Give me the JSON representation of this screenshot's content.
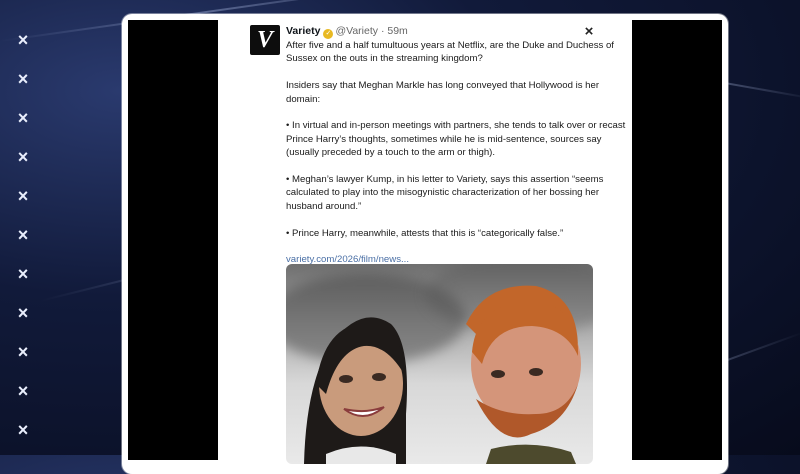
{
  "side_panel": {
    "close_icons": [
      "×",
      "×",
      "×",
      "×",
      "×",
      "×",
      "×",
      "×",
      "×",
      "×",
      "×",
      "×",
      "×",
      "×",
      "×",
      "×",
      "×",
      "×"
    ]
  },
  "tweet": {
    "account_name": "Variety",
    "handle": "@Variety",
    "separator": "·",
    "time_ago": "59m",
    "avatar_letter": "V",
    "verified_badge": "✓",
    "close_label": "×",
    "paragraphs": [
      "After five and a half tumultuous years at Netflix, are the Duke and Duchess of Sussex on the outs in the streaming kingdom?",
      "Insiders say that Meghan Markle has long conveyed that Hollywood is her domain:",
      "• In virtual and in-person meetings with partners, she tends to talk over or recast Prince Harry’s thoughts, sometimes while he is mid-sentence, sources say (usually preceded by a touch to the arm or thigh).",
      "• Meghan’s lawyer Kump, in his letter to Variety, says this assertion “seems calculated to play into the misogynistic characterization of her bossing her husband around.”",
      "• Prince Harry, meanwhile, attests that this is “categorically false.”"
    ],
    "link_text": "variety.com/2026/film/news..."
  },
  "colors": {
    "background": "#0a1128",
    "link": "#4a6fa5",
    "verified": "#e8b923"
  }
}
